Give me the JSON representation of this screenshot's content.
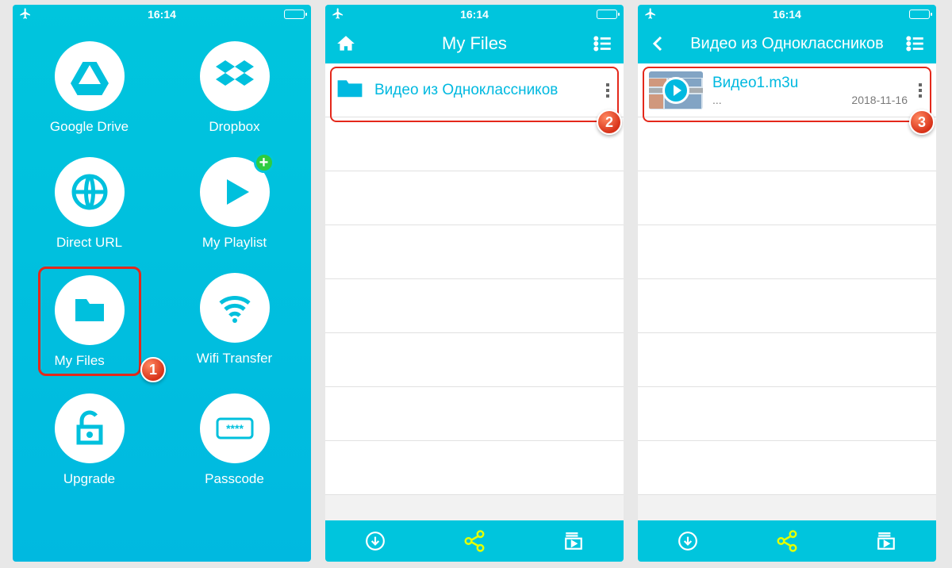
{
  "status": {
    "time": "16:14"
  },
  "home": {
    "tiles": [
      {
        "label": "Google Drive"
      },
      {
        "label": "Dropbox"
      },
      {
        "label": "Direct URL"
      },
      {
        "label": "My Playlist"
      },
      {
        "label": "My Files"
      },
      {
        "label": "Wifi Transfer"
      },
      {
        "label": "Upgrade"
      },
      {
        "label": "Passcode"
      }
    ]
  },
  "step_markers": {
    "one": "1",
    "two": "2",
    "three": "3"
  },
  "screen2": {
    "title": "My Files",
    "folder": {
      "name": "Видео из Одноклассников"
    }
  },
  "screen3": {
    "title": "Видео из Одноклассников",
    "file": {
      "name": "Видео1.m3u",
      "meta": "...",
      "date": "2018-11-16"
    }
  }
}
